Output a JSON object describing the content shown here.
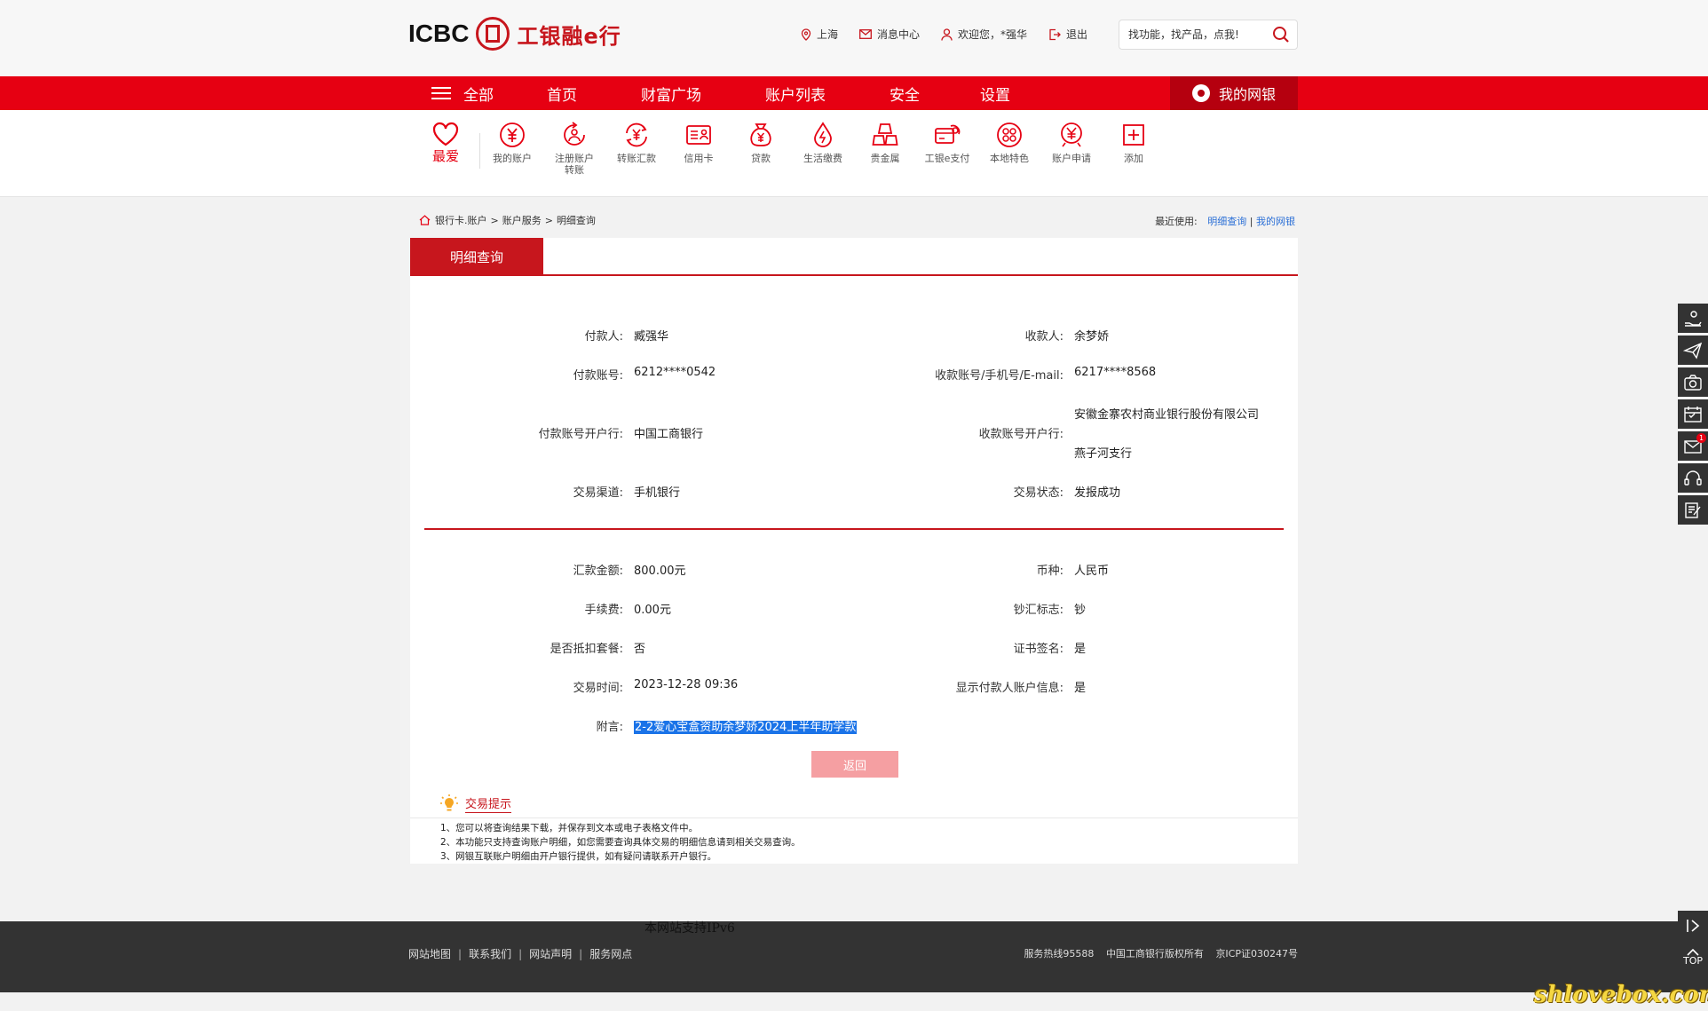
{
  "header": {
    "logo_en": "ICBC",
    "logo_cn": "工银融e行",
    "location": "上海",
    "messages": "消息中心",
    "welcome": "欢迎您，*强华",
    "logout": "退出",
    "search_placeholder": "找功能，找产品，点我!"
  },
  "nav": {
    "all": "全部",
    "items": [
      "首页",
      "财富广场",
      "账户列表",
      "安全",
      "设置"
    ],
    "my_bank": "我的网银"
  },
  "favorites": {
    "main_label": "最爱",
    "items": [
      "我的账户",
      "注册账户转账",
      "转账汇款",
      "信用卡",
      "贷款",
      "生活缴费",
      "贵金属",
      "工银e支付",
      "本地特色",
      "账户申请",
      "添加"
    ]
  },
  "breadcrumb": [
    "银行卡.账户",
    "账户服务",
    "明细查询"
  ],
  "recent": {
    "label": "最近使用:",
    "links": [
      "明细查询",
      "我的网银"
    ],
    "separator": "|"
  },
  "tab": {
    "label": "明细查询"
  },
  "details": {
    "payer_label": "付款人:",
    "payer": "臧强华",
    "payee_label": "收款人:",
    "payee": "余梦娇",
    "payer_account_label": "付款账号:",
    "payer_account": "6212****0542",
    "payee_account_label": "收款账号/手机号/E-mail:",
    "payee_account": "6217****8568",
    "payer_bank_label": "付款账号开户行:",
    "payer_bank": "中国工商银行",
    "payee_bank_label": "收款账号开户行:",
    "payee_bank_line1": "安徽金寨农村商业银行股份有限公司",
    "payee_bank_line2": "燕子河支行",
    "channel_label": "交易渠道:",
    "channel": "手机银行",
    "status_label": "交易状态:",
    "status": "发报成功",
    "amount_label": "汇款金额:",
    "amount": "800.00元",
    "currency_label": "币种:",
    "currency": "人民币",
    "fee_label": "手续费:",
    "fee": "0.00元",
    "cash_flag_label": "钞汇标志:",
    "cash_flag": "钞",
    "package_label": "是否抵扣套餐:",
    "package": "否",
    "cert_label": "证书签名:",
    "cert": "是",
    "time_label": "交易时间:",
    "time": "2023-12-28 09:36",
    "show_payer_label": "显示付款人账户信息:",
    "show_payer": "是",
    "memo_label": "附言:",
    "memo": "2-2爱心宝盒资助余梦娇2024上半年助学款"
  },
  "return_button": "返回",
  "tips": {
    "title": "交易提示",
    "items": [
      "1、您可以将查询结果下载，并保存到文本或电子表格文件中。",
      "2、本功能只支持查询账户明细，如您需要查询具体交易的明细信息请到相关交易查询。",
      "3、网银互联账户明细由开户银行提供，如有疑问请联系开户银行。"
    ]
  },
  "footer": {
    "ipv6": "本网站支持IPv6",
    "links": [
      "网站地图",
      "联系我们",
      "网站声明",
      "服务网点"
    ],
    "hotline": "服务热线95588",
    "copyright": "中国工商银行版权所有",
    "icp": "京ICP证030247号"
  },
  "sidebar": {
    "badge": "1",
    "top": "TOP"
  },
  "watermark": "shlovebox.com",
  "colors": {
    "brand_red": "#e60012",
    "dark_red": "#c7161d",
    "link_blue": "#2a6fd6"
  }
}
